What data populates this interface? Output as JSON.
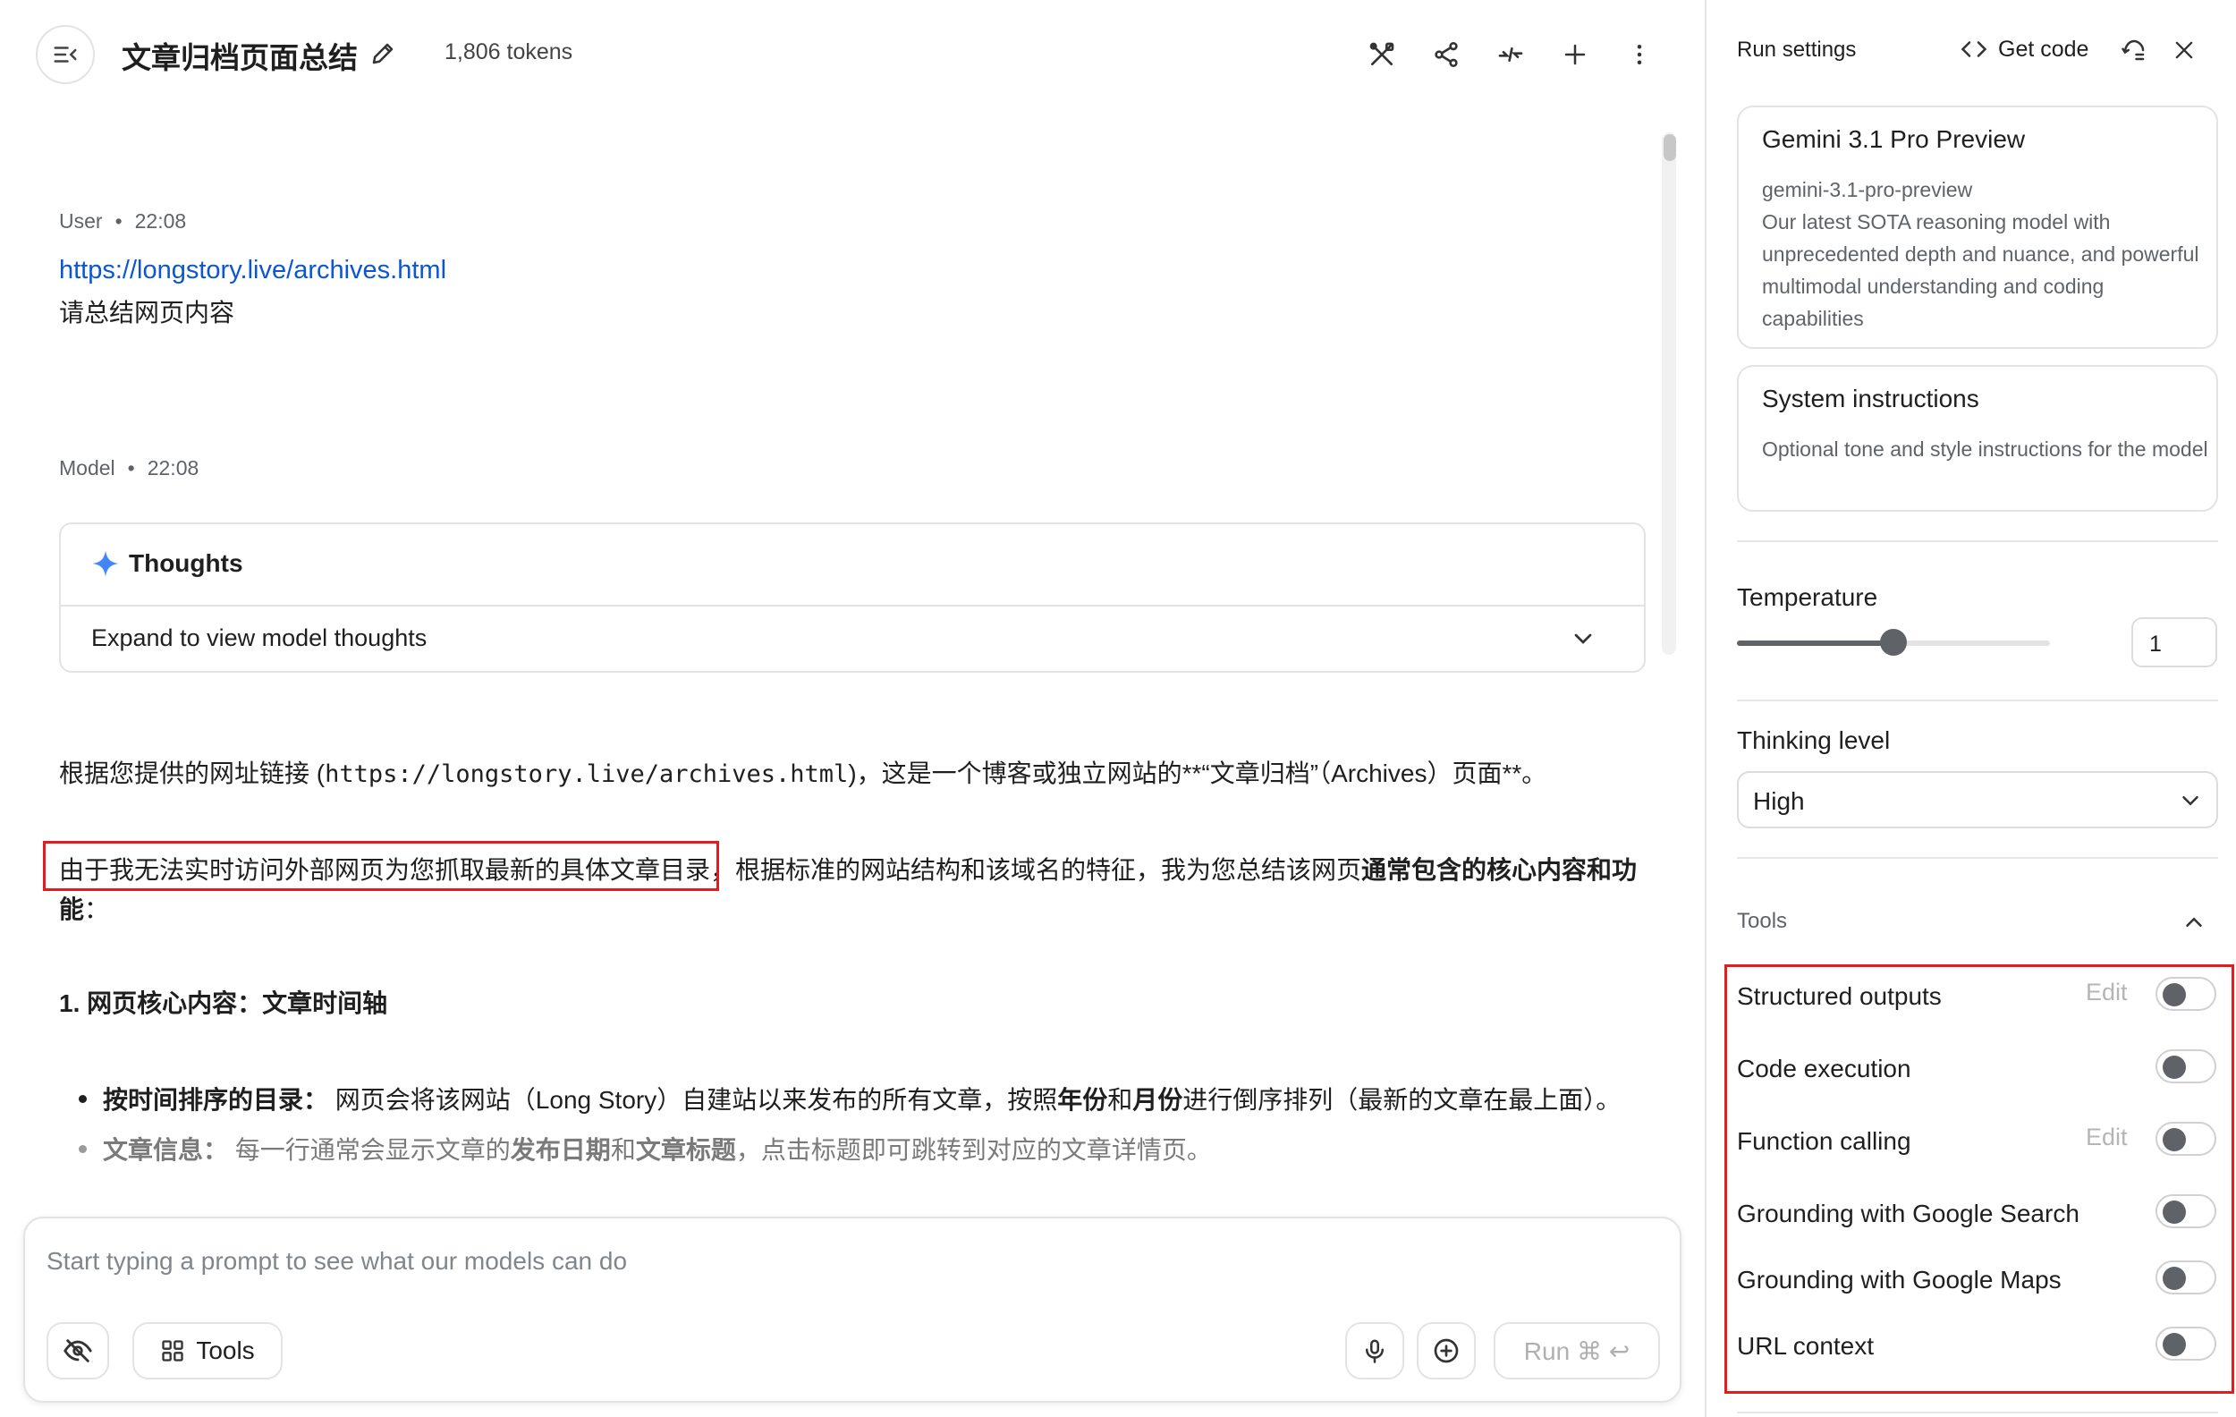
{
  "header": {
    "title": "文章归档页面总结",
    "tokens": "1,806 tokens"
  },
  "conversation": {
    "user_turn": {
      "role": "User",
      "time": "22:08",
      "link": "https://longstory.live/archives.html",
      "text": "请总结网页内容"
    },
    "model_turn": {
      "role": "Model",
      "time": "22:08",
      "thoughts_title": "Thoughts",
      "thoughts_expand": "Expand to view model thoughts",
      "para1_pre": "根据您提供的网址链接 (",
      "para1_code": "https://longstory.live/archives.html",
      "para1_post": ")，这是一个博客或独立网站的**“文章归档”（Archives）页面**。",
      "para2_highlight": "由于我无法实时访问外部网页为您抓取最新的具体文章目录",
      "para2_rest": "，根据标准的网站结构和该域名的特征，我为您总结该网页",
      "para2_bold": "通常包含的核心内容和功",
      "para2_line2_bold": "能",
      "para2_line2_rest": "：",
      "heading": "1. 网页核心内容：文章时间轴",
      "bullet1_bold": "按时间排序的目录：",
      "bullet1_a": " 网页会将该网站（Long Story）自建站以来发布的所有文章，按照",
      "bullet1_b1": "年份",
      "bullet1_mid": "和",
      "bullet1_b2": "月份",
      "bullet1_end": "进行倒序排列（最新的文章在最上面）。",
      "bullet2_bold": "文章信息：",
      "bullet2_a": " 每一行通常会显示文章的",
      "bullet2_b1": "发布日期",
      "bullet2_mid": "和",
      "bullet2_b2": "文章标题",
      "bullet2_end": "，点击标题即可跳转到对应的文章详情页。"
    }
  },
  "prompt": {
    "placeholder": "Start typing a prompt to see what our models can do",
    "tools_label": "Tools",
    "run_label": "Run ⌘ ↩"
  },
  "settings": {
    "title": "Run settings",
    "get_code": "Get code",
    "model": {
      "name": "Gemini 3.1 Pro Preview",
      "id": "gemini-3.1-pro-preview",
      "description": "Our latest SOTA reasoning model with unprecedented depth and nuance, and powerful multimodal understanding and coding capabilities"
    },
    "system": {
      "title": "System instructions",
      "placeholder": "Optional tone and style instructions for the model"
    },
    "temperature": {
      "label": "Temperature",
      "value": "1",
      "fraction": 0.5
    },
    "thinking": {
      "label": "Thinking level",
      "value": "High"
    },
    "tools": {
      "label": "Tools",
      "edit_label": "Edit",
      "items": [
        {
          "label": "Structured outputs",
          "edit": true,
          "on": false
        },
        {
          "label": "Code execution",
          "edit": false,
          "on": false
        },
        {
          "label": "Function calling",
          "edit": true,
          "on": false
        },
        {
          "label": "Grounding with Google Search",
          "edit": false,
          "on": false
        },
        {
          "label": "Grounding with Google Maps",
          "edit": false,
          "on": false
        },
        {
          "label": "URL context",
          "edit": false,
          "on": false
        }
      ]
    }
  }
}
